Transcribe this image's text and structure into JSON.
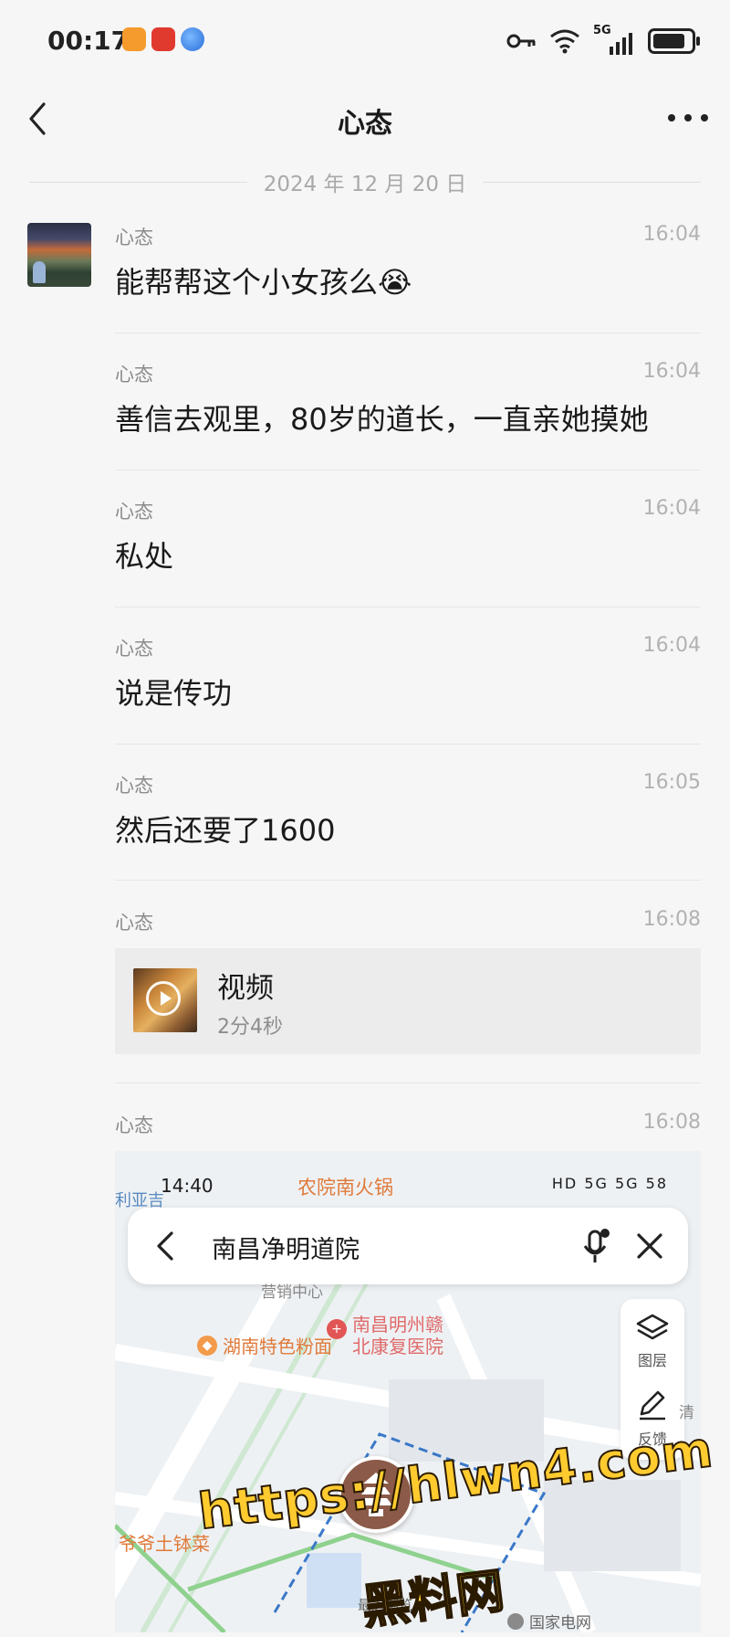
{
  "status_bar": {
    "time": "00:17",
    "network": "5G",
    "app_icons": [
      "browser-app-icon",
      "taobao-app-icon",
      "planet-app-icon"
    ]
  },
  "nav": {
    "title": "心态",
    "back_icon": "chevron-left-icon",
    "more_icon": "more-icon"
  },
  "date_separator": "2024 年 12 月 20 日",
  "messages": [
    {
      "sender": "心态",
      "time": "16:04",
      "text": "能帮帮这个小女孩么😭"
    },
    {
      "sender": "心态",
      "time": "16:04",
      "text": "善信去观里，80岁的道长，一直亲她摸她"
    },
    {
      "sender": "心态",
      "time": "16:04",
      "text": "私处"
    },
    {
      "sender": "心态",
      "time": "16:04",
      "text": "说是传功"
    },
    {
      "sender": "心态",
      "time": "16:05",
      "text": "然后还要了1600"
    },
    {
      "sender": "心态",
      "time": "16:08"
    },
    {
      "sender": "心态",
      "time": "16:08"
    }
  ],
  "video": {
    "title": "视频",
    "duration": "2分4秒"
  },
  "map_screenshot": {
    "time": "14:40",
    "top_poi": "农院南火锅",
    "status_right": "HD 5G 5G 58",
    "search_query": "南昌净明道院",
    "tools": [
      "图层",
      "反馈"
    ],
    "pois": [
      "湖南特色粉面",
      "南昌明州赣北康复医院",
      "爷爷土钵菜",
      "利亚吉",
      "营销中心",
      "最近浏览",
      "国家电网",
      "清"
    ]
  },
  "watermark": {
    "url": "https://hlwn4.com",
    "name": "黑料网"
  },
  "colors": {
    "background": "#f6f6f6",
    "accent_watermark": "#ffcb2f",
    "pin": "#8c5a48"
  }
}
